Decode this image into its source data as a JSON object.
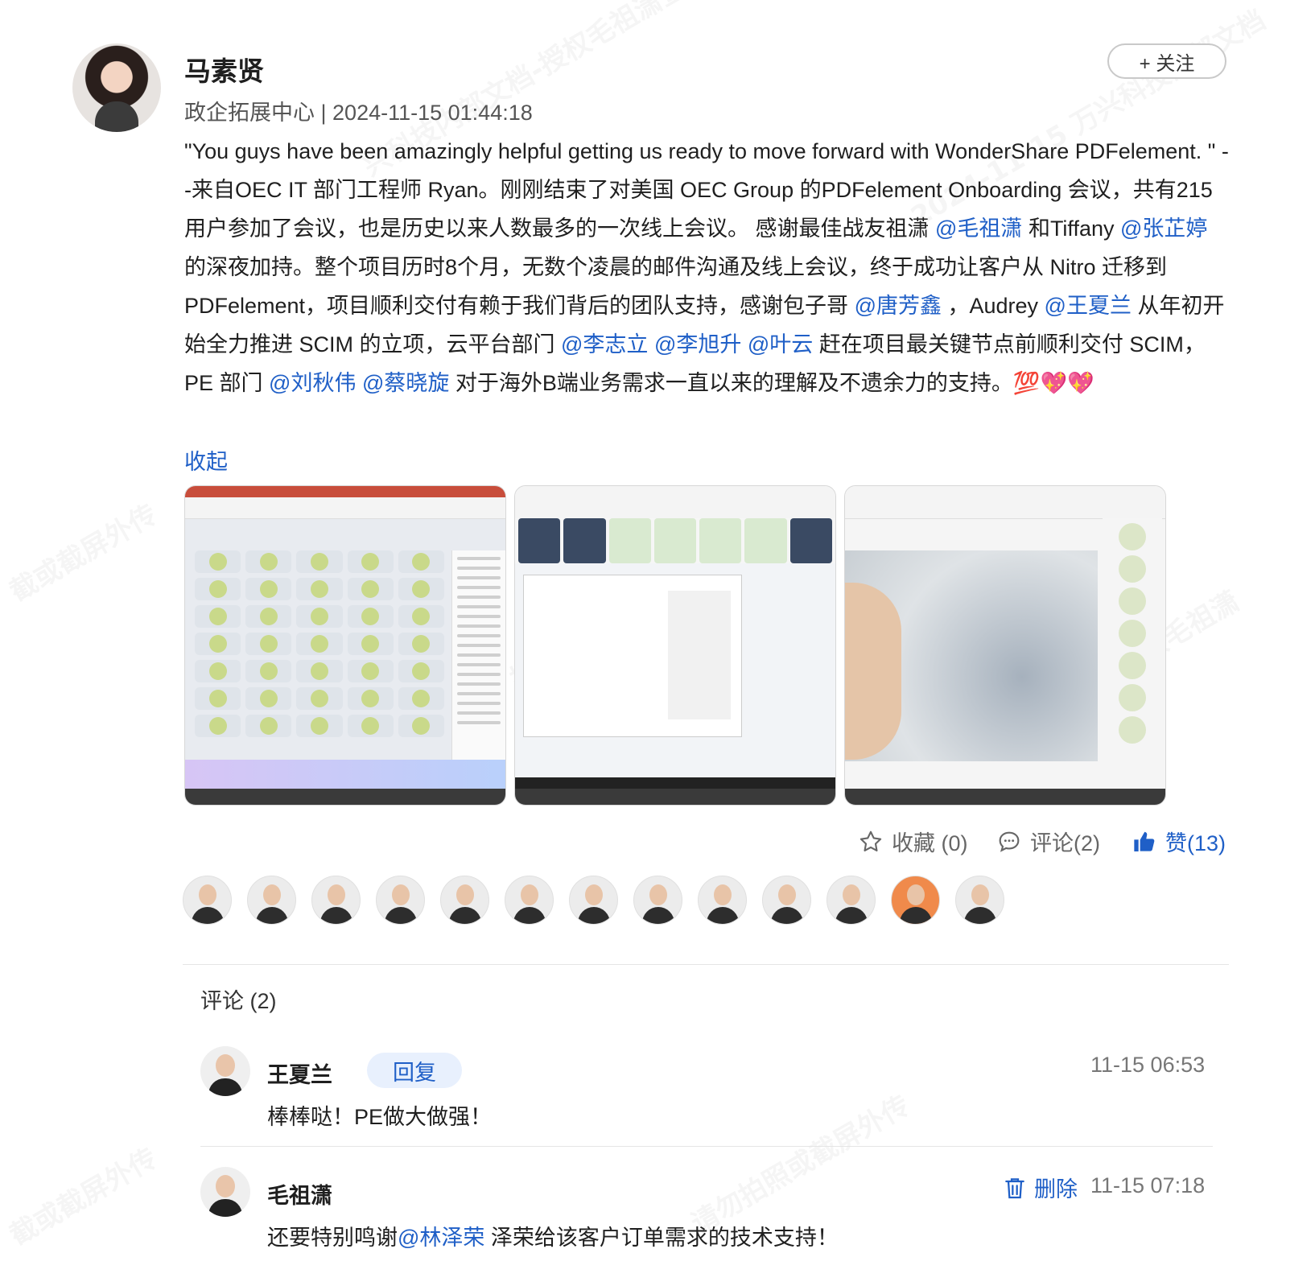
{
  "post": {
    "author": "马素贤",
    "department": "政企拓展中心",
    "timestamp": "2024-11-15 01:44:18",
    "follow_label": "+ 关注",
    "body_parts": [
      {
        "t": "\"You guys have been amazingly helpful getting us ready to move forward with WonderShare PDFelement. \" --来自OEC IT 部门工程师 Ryan。刚刚结束了对美国 OEC Group 的PDFelement Onboarding 会议，共有215 用户参加了会议，也是历史以来人数最多的一次线上会议。 感谢最佳战友祖潇 "
      },
      {
        "m": "@毛祖潇"
      },
      {
        "t": " 和Tiffany "
      },
      {
        "m": "@张芷婷"
      },
      {
        "t": " 的深夜加持。整个项目历时8个月，无数个凌晨的邮件沟通及线上会议，终于成功让客户从 Nitro 迁移到 PDFelement，项目顺利交付有赖于我们背后的团队支持，感谢包子哥 "
      },
      {
        "m": "@唐芳鑫"
      },
      {
        "t": " ，Audrey "
      },
      {
        "m": "@王夏兰"
      },
      {
        "t": " 从年初开始全力推进 SCIM 的立项，云平台部门 "
      },
      {
        "m": "@李志立"
      },
      {
        "t": " "
      },
      {
        "m": "@李旭升"
      },
      {
        "t": " "
      },
      {
        "m": "@叶云"
      },
      {
        "t": " 赶在项目最关键节点前顺利交付 SCIM，PE 部门 "
      },
      {
        "m": "@刘秋伟"
      },
      {
        "t": " "
      },
      {
        "m": "@蔡晓旋"
      },
      {
        "t": " 对于海外B端业务需求一直以来的理解及不遗余力的支持。💯💖💖"
      }
    ],
    "collapse_label": "收起"
  },
  "actions": {
    "favorite_label": "收藏 (0)",
    "comment_label": "评论(2)",
    "like_label": "赞(13)"
  },
  "likers_count": 13,
  "comments": {
    "title": "评论 (2)",
    "items": [
      {
        "name": "王夏兰",
        "reply_label": "回复",
        "time": "11-15 06:53",
        "text": "棒棒哒！PE做大做强！"
      },
      {
        "name": "毛祖潇",
        "delete_label": "删除",
        "time": "11-15 07:18",
        "text_pre": "还要特别鸣谢",
        "mention": "@林泽荣",
        "text_post": " 泽荣给该客户订单需求的技术支持！"
      }
    ]
  },
  "colors": {
    "accent": "#1f5fc7",
    "muted": "#777777"
  }
}
